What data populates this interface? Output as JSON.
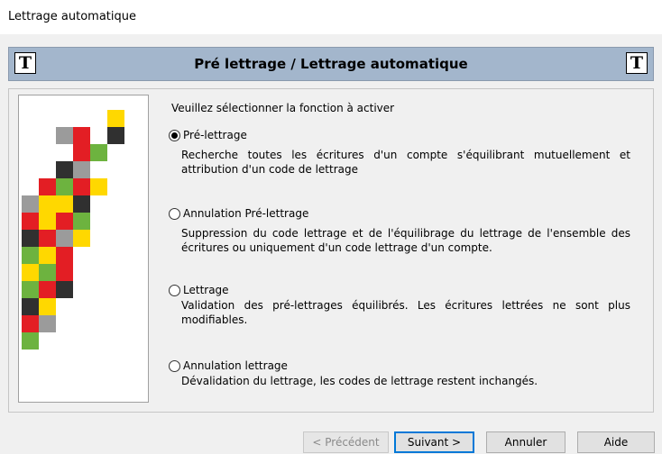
{
  "window": {
    "title": "Lettrage automatique"
  },
  "banner": {
    "title": "Pré lettrage / Lettrage automatique",
    "icon_glyph": "T"
  },
  "prompt": "Veuillez sélectionner la fonction à activer",
  "options": [
    {
      "label": "Pré-lettrage",
      "checked": true,
      "description": "Recherche toutes les écritures d'un compte s'équilibrant mutuellement et attribution d'un code de lettrage"
    },
    {
      "label": "Annulation Pré-lettrage",
      "checked": false,
      "description": "Suppression du code lettrage et de l'équilibrage du lettrage de l'ensemble des écritures ou uniquement d'un code lettrage d'un compte."
    },
    {
      "label": "Lettrage",
      "checked": false,
      "description": "Validation des pré-lettrages équilibrés. Les écritures lettrées ne sont plus modifiables."
    },
    {
      "label": "Annulation lettrage",
      "checked": false,
      "description": "Dévalidation du lettrage, les codes de lettrage restent inchangés."
    }
  ],
  "buttons": {
    "previous": "< Précédent",
    "next": "Suivant >",
    "cancel": "Annuler",
    "help": "Aide"
  },
  "colors": {
    "banner": "#a3b6cc",
    "mosaic_yellow": "#ffd800",
    "mosaic_red": "#e31e24",
    "mosaic_green": "#6db33f",
    "mosaic_gray": "#9b9b9b",
    "mosaic_dark": "#303030"
  }
}
